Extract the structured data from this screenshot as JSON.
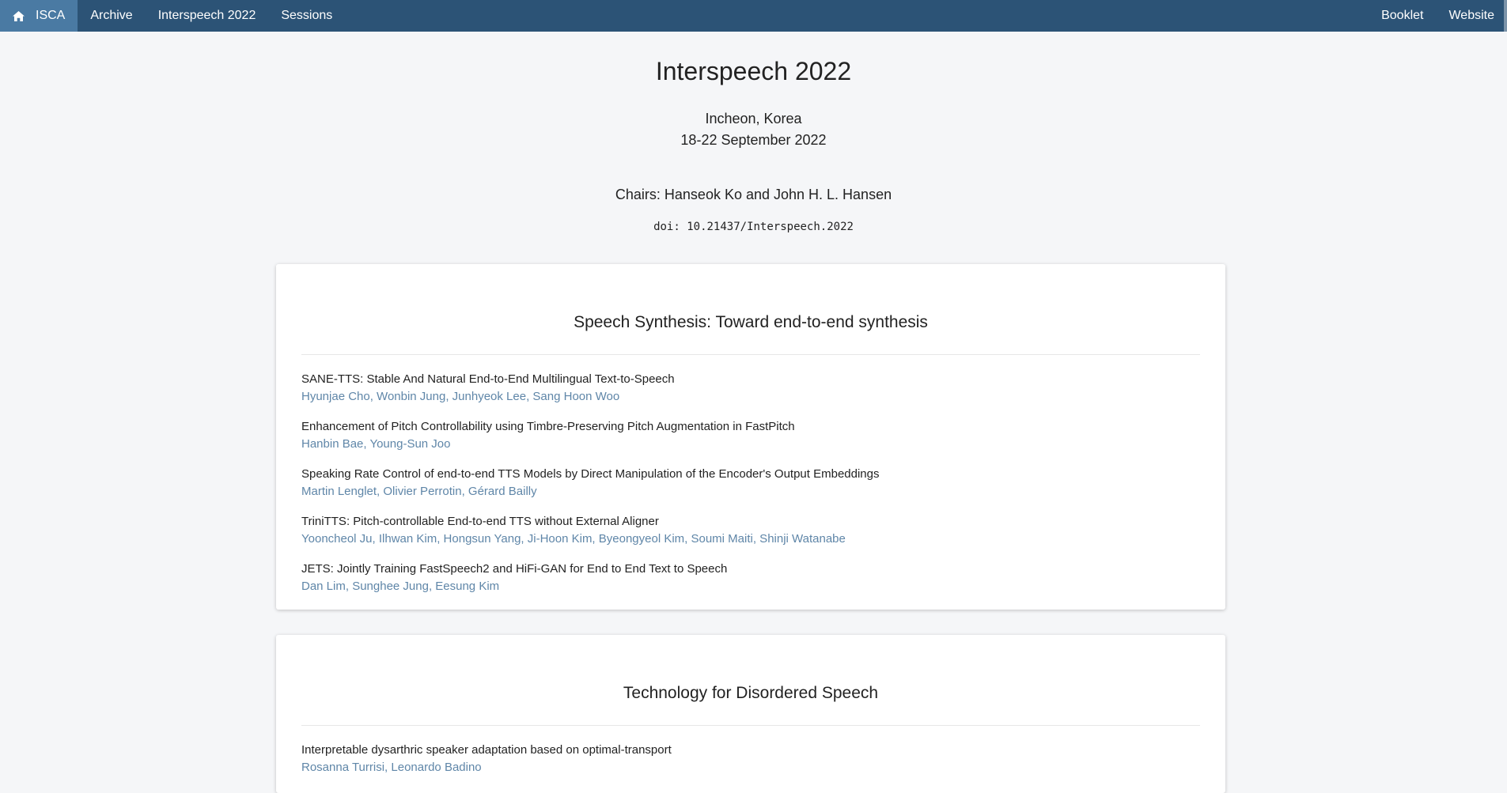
{
  "nav": {
    "home_label": "ISCA",
    "archive_label": "Archive",
    "conference_label": "Interspeech 2022",
    "sessions_label": "Sessions",
    "booklet_label": "Booklet",
    "website_label": "Website",
    "bar_color": "#2c5376",
    "active_color": "#4a7aa3"
  },
  "conference": {
    "title": "Interspeech 2022",
    "location": "Incheon, Korea",
    "dates": "18-22 September 2022",
    "chairs": "Chairs: Hanseok Ko and John H. L. Hansen",
    "doi": "doi: 10.21437/Interspeech.2022"
  },
  "sessions": [
    {
      "title": "Speech Synthesis: Toward end-to-end synthesis",
      "papers": [
        {
          "title": "SANE-TTS: Stable And Natural End-to-End Multilingual Text-to-Speech",
          "authors": "Hyunjae Cho, Wonbin Jung, Junhyeok Lee, Sang Hoon Woo"
        },
        {
          "title": "Enhancement of Pitch Controllability using Timbre-Preserving Pitch Augmentation in FastPitch",
          "authors": "Hanbin Bae, Young-Sun Joo"
        },
        {
          "title": "Speaking Rate Control of end-to-end TTS Models by Direct Manipulation of the Encoder's Output Embeddings",
          "authors": "Martin Lenglet, Olivier Perrotin, Gérard Bailly"
        },
        {
          "title": "TriniTTS: Pitch-controllable End-to-end TTS without External Aligner",
          "authors": "Yooncheol Ju, Ilhwan Kim, Hongsun Yang, Ji-Hoon Kim, Byeongyeol Kim, Soumi Maiti, Shinji Watanabe"
        },
        {
          "title": "JETS: Jointly Training FastSpeech2 and HiFi-GAN for End to End Text to Speech",
          "authors": "Dan Lim, Sunghee Jung, Eesung Kim"
        }
      ]
    },
    {
      "title": "Technology for Disordered Speech",
      "papers": [
        {
          "title": "Interpretable dysarthric speaker adaptation based on optimal-transport",
          "authors": "Rosanna Turrisi, Leonardo Badino"
        }
      ]
    }
  ]
}
